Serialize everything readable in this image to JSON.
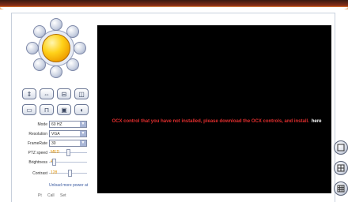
{
  "controls": {
    "mode": {
      "label": "Mode",
      "value": "60 HZ"
    },
    "resolution": {
      "label": "Resolution",
      "value": "VGA"
    },
    "framerate": {
      "label": "FrameRate",
      "value": "30"
    },
    "ptz_speed": {
      "label": "PTZ speed",
      "value": "MED",
      "level": 0.5
    },
    "brightness": {
      "label": "Brightness",
      "value": "4",
      "level": 0.1
    },
    "contrast": {
      "label": "Contrast",
      "value": "128",
      "level": 0.55
    }
  },
  "footer": {
    "link": "Unload more power at",
    "preset_label": "Pt",
    "call_label": "Call",
    "set_label": "Set"
  },
  "video": {
    "message": "OCX control that you have not installed, please download the OCX controls, and install.",
    "link": "here"
  },
  "colors": {
    "accent": "#c84a1e",
    "message": "#e02d2d",
    "video_bg": "#000000"
  }
}
